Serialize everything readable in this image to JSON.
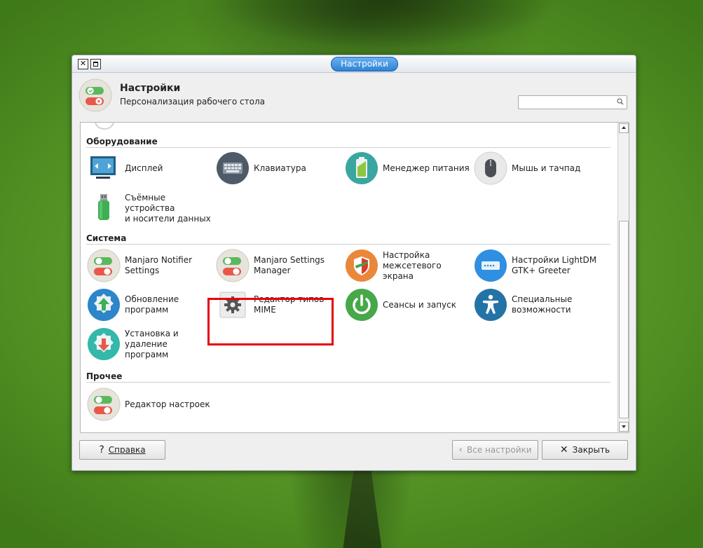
{
  "window": {
    "title": "Настройки"
  },
  "header": {
    "title": "Настройки",
    "subtitle": "Персонализация рабочего стола",
    "search_value": "",
    "search_placeholder": ""
  },
  "categories": [
    {
      "name": "Оборудование",
      "items": [
        {
          "label": [
            "Дисплей"
          ],
          "icon": "display-icon"
        },
        {
          "label": [
            "Клавиатура"
          ],
          "icon": "keyboard-icon"
        },
        {
          "label": [
            "Менеджер питания"
          ],
          "icon": "battery-icon"
        },
        {
          "label": [
            "Мышь и тачпад"
          ],
          "icon": "mouse-icon"
        },
        {
          "label": [
            "Съёмные устройства",
            "и носители данных"
          ],
          "icon": "usb-drive-icon"
        }
      ]
    },
    {
      "name": "Система",
      "items": [
        {
          "label": [
            "Manjaro Notifier",
            "Settings"
          ],
          "icon": "toggles-icon"
        },
        {
          "label": [
            "Manjaro Settings",
            "Manager"
          ],
          "icon": "toggles-icon"
        },
        {
          "label": [
            "Настройка",
            "межсетевого экрана"
          ],
          "icon": "firewall-shield-icon"
        },
        {
          "label": [
            "Настройки LightDM",
            "GTK+ Greeter"
          ],
          "icon": "login-screen-icon"
        },
        {
          "label": [
            "Обновление",
            "программ"
          ],
          "icon": "update-icon"
        },
        {
          "label": [
            "Редактор типов MIME"
          ],
          "icon": "gear-icon"
        },
        {
          "label": [
            "Сеансы и запуск"
          ],
          "icon": "power-icon"
        },
        {
          "label": [
            "Специальные",
            "возможности"
          ],
          "icon": "accessibility-icon"
        },
        {
          "label": [
            "Установка и",
            "удаление программ"
          ],
          "icon": "install-remove-icon"
        }
      ]
    },
    {
      "name": "Прочее",
      "items": [
        {
          "label": [
            "Редактор настроек"
          ],
          "icon": "toggles-icon"
        }
      ]
    }
  ],
  "buttons": {
    "help": {
      "prefix": "?",
      "label": "Справка"
    },
    "all_settings": {
      "label": "Все настройки",
      "enabled": false
    },
    "close": {
      "label": "Закрыть"
    }
  },
  "colors": {
    "accent": "#2e83d6",
    "highlight": "#e5000b",
    "desktop": "#5d9c2c"
  }
}
